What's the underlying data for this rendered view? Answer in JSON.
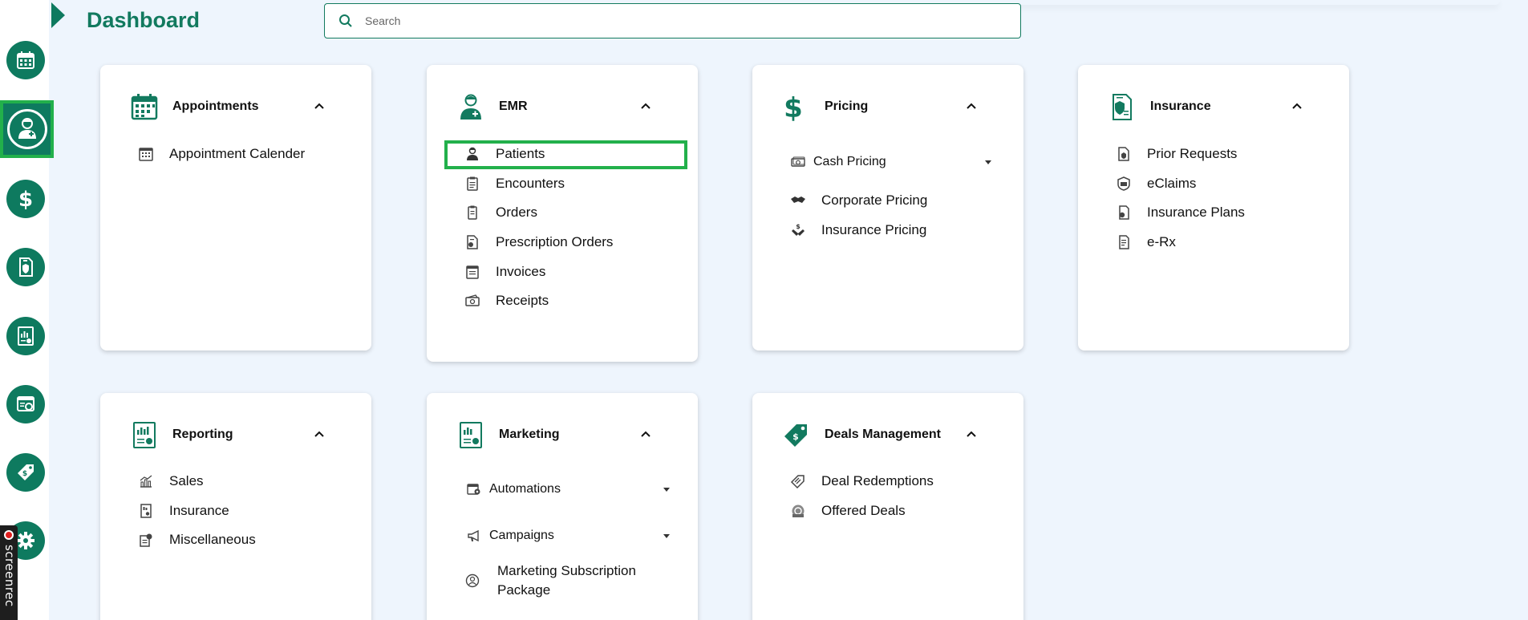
{
  "header": {
    "title": "Dashboard",
    "search_placeholder": "Search"
  },
  "sidebar": {
    "items": [
      {
        "icon": "calendar-icon"
      },
      {
        "icon": "doctor-icon",
        "active": true
      },
      {
        "icon": "dollar-icon"
      },
      {
        "icon": "insurance-doc-icon"
      },
      {
        "icon": "report-icon"
      },
      {
        "icon": "marketing-icon"
      },
      {
        "icon": "deal-tag-icon"
      },
      {
        "icon": "gear-icon"
      }
    ]
  },
  "watermark": {
    "text": "screenrec"
  },
  "cards": {
    "appointments": {
      "title": "Appointments",
      "items": [
        {
          "label": "Appointment Calender",
          "icon": "calendar-small-icon"
        }
      ]
    },
    "emr": {
      "title": "EMR",
      "items": [
        {
          "label": "Patients",
          "icon": "patient-icon"
        },
        {
          "label": "Encounters",
          "icon": "clipboard-icon"
        },
        {
          "label": "Orders",
          "icon": "order-icon"
        },
        {
          "label": "Prescription Orders",
          "icon": "prescription-icon"
        },
        {
          "label": "Invoices",
          "icon": "invoice-icon"
        },
        {
          "label": "Receipts",
          "icon": "receipt-icon"
        }
      ]
    },
    "pricing": {
      "title": "Pricing",
      "items": [
        {
          "label": "Cash Pricing",
          "icon": "cash-icon"
        },
        {
          "label": "Corporate Pricing",
          "icon": "handshake-icon"
        },
        {
          "label": "Insurance Pricing",
          "icon": "money-hand-icon"
        }
      ]
    },
    "insurance": {
      "title": "Insurance",
      "items": [
        {
          "label": "Prior Requests",
          "icon": "request-icon"
        },
        {
          "label": "eClaims",
          "icon": "eclaim-icon"
        },
        {
          "label": "Insurance Plans",
          "icon": "plan-icon"
        },
        {
          "label": "e-Rx",
          "icon": "erx-icon"
        }
      ]
    },
    "reporting": {
      "title": "Reporting",
      "items": [
        {
          "label": "Sales",
          "icon": "sales-icon"
        },
        {
          "label": "Insurance",
          "icon": "insurance-report-icon"
        },
        {
          "label": "Miscellaneous",
          "icon": "misc-icon"
        }
      ]
    },
    "marketing": {
      "title": "Marketing",
      "items": [
        {
          "label": "Automations",
          "icon": "automation-icon"
        },
        {
          "label": "Campaigns",
          "icon": "megaphone-icon"
        },
        {
          "label": "Marketing Subscription Package",
          "icon": "subscription-icon"
        }
      ]
    },
    "deals": {
      "title": "Deals Management",
      "items": [
        {
          "label": "Deal Redemptions",
          "icon": "redemption-icon"
        },
        {
          "label": "Offered Deals",
          "icon": "offer-icon"
        }
      ]
    }
  },
  "colors": {
    "brand": "#127a5f",
    "highlight": "#22b04b",
    "background": "#eef5fd"
  }
}
